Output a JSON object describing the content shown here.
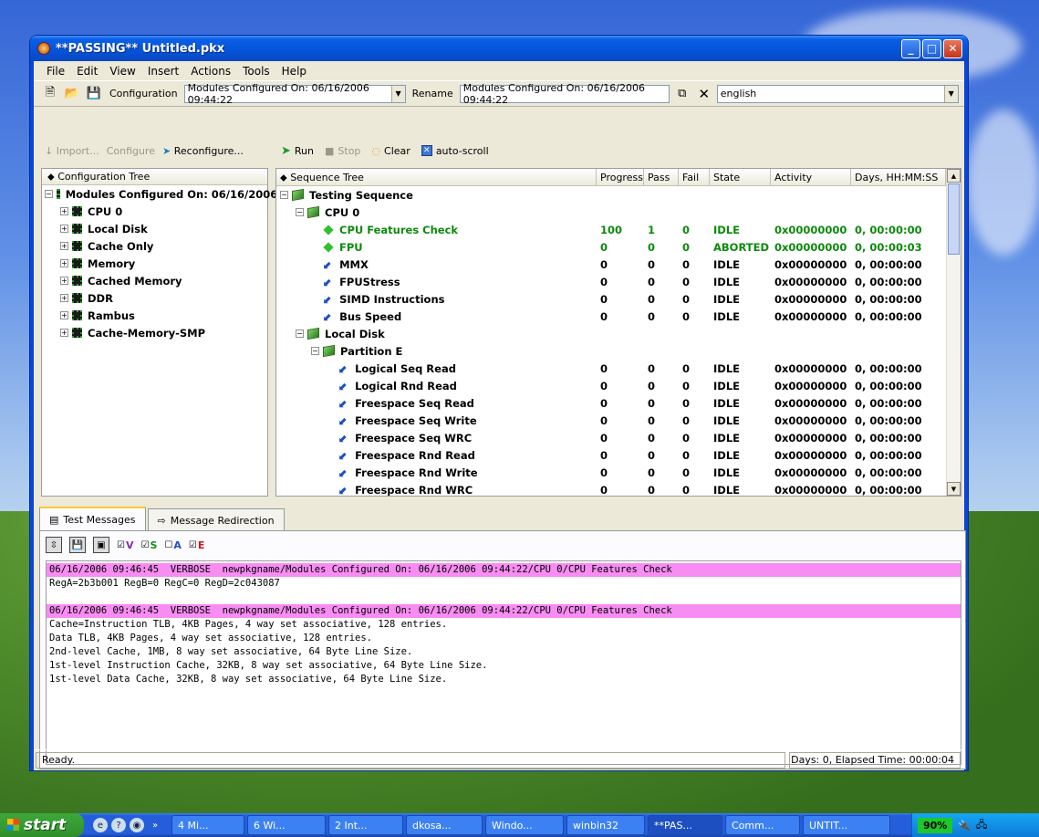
{
  "window": {
    "title": "**PASSING** Untitled.pkx"
  },
  "menu": [
    "File",
    "Edit",
    "View",
    "Insert",
    "Actions",
    "Tools",
    "Help"
  ],
  "toolbar": {
    "config_label": "Configuration",
    "config_value": "Modules Configured On: 06/16/2006 09:44:22",
    "rename_label": "Rename",
    "rename_value": "Modules Configured On: 06/16/2006 09:44:22",
    "language_value": "english"
  },
  "left": {
    "import": "Import...",
    "configure": "Configure",
    "reconfigure": "Reconfigure...",
    "tree_header": "Configuration Tree",
    "root": "Modules Configured On: 06/16/2006...",
    "items": [
      "CPU 0",
      "Local Disk",
      "Cache Only",
      "Memory",
      "Cached Memory",
      "DDR",
      "Rambus",
      "Cache-Memory-SMP"
    ]
  },
  "right": {
    "run": "Run",
    "stop": "Stop",
    "clear": "Clear",
    "autoscroll": "auto-scroll",
    "columns": [
      "Sequence Tree",
      "Progress",
      "Pass",
      "Fail",
      "State",
      "Activity",
      "Days, HH:MM:SS"
    ],
    "rows": [
      {
        "name": "Testing Sequence",
        "level": 0,
        "kind": "folder"
      },
      {
        "name": "CPU 0",
        "level": 1,
        "kind": "folder"
      },
      {
        "name": "CPU Features Check",
        "level": 2,
        "kind": "diamond",
        "progress": "100",
        "pass": "1",
        "fail": "0",
        "state": "IDLE",
        "activity": "0x00000000",
        "time": "0, 00:00:00",
        "green": true
      },
      {
        "name": "FPU",
        "level": 2,
        "kind": "diamond",
        "progress": "0",
        "pass": "0",
        "fail": "0",
        "state": "ABORTED",
        "activity": "0x00000000",
        "time": "0, 00:00:03",
        "green": true
      },
      {
        "name": "MMX",
        "level": 2,
        "kind": "arrow",
        "progress": "0",
        "pass": "0",
        "fail": "0",
        "state": "IDLE",
        "activity": "0x00000000",
        "time": "0, 00:00:00"
      },
      {
        "name": "FPUStress",
        "level": 2,
        "kind": "arrow",
        "progress": "0",
        "pass": "0",
        "fail": "0",
        "state": "IDLE",
        "activity": "0x00000000",
        "time": "0, 00:00:00"
      },
      {
        "name": "SIMD Instructions",
        "level": 2,
        "kind": "arrow",
        "progress": "0",
        "pass": "0",
        "fail": "0",
        "state": "IDLE",
        "activity": "0x00000000",
        "time": "0, 00:00:00"
      },
      {
        "name": "Bus Speed",
        "level": 2,
        "kind": "arrow",
        "progress": "0",
        "pass": "0",
        "fail": "0",
        "state": "IDLE",
        "activity": "0x00000000",
        "time": "0, 00:00:00"
      },
      {
        "name": "Local Disk",
        "level": 1,
        "kind": "folder"
      },
      {
        "name": "Partition E",
        "level": 2,
        "kind": "folder"
      },
      {
        "name": "Logical Seq Read",
        "level": 3,
        "kind": "arrow",
        "progress": "0",
        "pass": "0",
        "fail": "0",
        "state": "IDLE",
        "activity": "0x00000000",
        "time": "0, 00:00:00"
      },
      {
        "name": "Logical Rnd Read",
        "level": 3,
        "kind": "arrow",
        "progress": "0",
        "pass": "0",
        "fail": "0",
        "state": "IDLE",
        "activity": "0x00000000",
        "time": "0, 00:00:00"
      },
      {
        "name": "Freespace Seq Read",
        "level": 3,
        "kind": "arrow",
        "progress": "0",
        "pass": "0",
        "fail": "0",
        "state": "IDLE",
        "activity": "0x00000000",
        "time": "0, 00:00:00"
      },
      {
        "name": "Freespace Seq Write",
        "level": 3,
        "kind": "arrow",
        "progress": "0",
        "pass": "0",
        "fail": "0",
        "state": "IDLE",
        "activity": "0x00000000",
        "time": "0, 00:00:00"
      },
      {
        "name": "Freespace Seq WRC",
        "level": 3,
        "kind": "arrow",
        "progress": "0",
        "pass": "0",
        "fail": "0",
        "state": "IDLE",
        "activity": "0x00000000",
        "time": "0, 00:00:00"
      },
      {
        "name": "Freespace Rnd Read",
        "level": 3,
        "kind": "arrow",
        "progress": "0",
        "pass": "0",
        "fail": "0",
        "state": "IDLE",
        "activity": "0x00000000",
        "time": "0, 00:00:00"
      },
      {
        "name": "Freespace Rnd Write",
        "level": 3,
        "kind": "arrow",
        "progress": "0",
        "pass": "0",
        "fail": "0",
        "state": "IDLE",
        "activity": "0x00000000",
        "time": "0, 00:00:00"
      },
      {
        "name": "Freespace Rnd WRC",
        "level": 3,
        "kind": "arrow",
        "progress": "0",
        "pass": "0",
        "fail": "0",
        "state": "IDLE",
        "activity": "0x00000000",
        "time": "0, 00:00:00"
      }
    ]
  },
  "tabs": {
    "messages": "Test Messages",
    "redirection": "Message Redirection"
  },
  "msgfilters": [
    "V",
    "S",
    "A",
    "E"
  ],
  "messages": [
    {
      "text": "06/16/2006 09:46:45  VERBOSE  newpkgname/Modules Configured On: 06/16/2006 09:44:22/CPU 0/CPU Features Check",
      "hi": true
    },
    {
      "text": "RegA=2b3b001 RegB=0 RegC=0 RegD=2c043087",
      "hi": false
    },
    {
      "text": "",
      "hi": false
    },
    {
      "text": "06/16/2006 09:46:45  VERBOSE  newpkgname/Modules Configured On: 06/16/2006 09:44:22/CPU 0/CPU Features Check",
      "hi": true
    },
    {
      "text": "Cache=Instruction TLB, 4KB Pages, 4 way set associative, 128 entries.",
      "hi": false
    },
    {
      "text": "Data TLB, 4KB Pages, 4 way set associative, 128 entries.",
      "hi": false
    },
    {
      "text": "2nd-level Cache, 1MB, 8 way set associative, 64 Byte Line Size.",
      "hi": false
    },
    {
      "text": "1st-level Instruction Cache, 32KB, 8 way set associative, 64 Byte Line Size.",
      "hi": false
    },
    {
      "text": "1st-level Data Cache, 32KB, 8 way set associative, 64 Byte Line Size.",
      "hi": false
    }
  ],
  "status": {
    "left": "Ready.",
    "right": "Days: 0,  Elapsed Time: 00:00:04"
  },
  "taskbar": {
    "start": "start",
    "tasks": [
      "4 Mi...",
      "6 Wi...",
      "2 Int...",
      "dkosa...",
      "Windo...",
      "winbin32",
      "**PAS...",
      "Comm...",
      "UNTIT..."
    ],
    "battery": "90%"
  }
}
